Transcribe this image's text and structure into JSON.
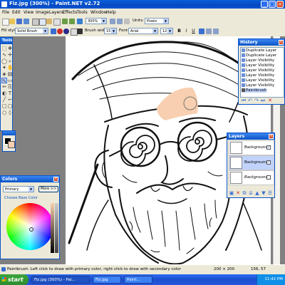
{
  "window": {
    "title": "Fiz.jpg (300%) - Paint.NET v2.72",
    "min_glyph": "_",
    "max_glyph": "□",
    "close_glyph": "×"
  },
  "menu": [
    "File",
    "Edit",
    "View",
    "Image",
    "Layers",
    "Effects",
    "Tools",
    "Window",
    "Help"
  ],
  "toolbar1": {
    "zoom_value": "300%",
    "units_label": "Units:",
    "units_value": "Pixels"
  },
  "toolbar2": {
    "fill_label": "Fill style:",
    "fill_value": "Solid Brush",
    "brush_width_label": "Brush width:",
    "brush_width_value": "15",
    "font_label": "Font:",
    "font_value": "Arial",
    "font_size_value": "12",
    "bold": "B",
    "italic": "I",
    "underline": "U"
  },
  "tools_panel": {
    "title": "Tools",
    "close_glyph": "×"
  },
  "history_panel": {
    "title": "History",
    "close_glyph": "×",
    "items": [
      "Duplicate Layer",
      "Duplicate Layer",
      "Layer Visibility",
      "Layer Visibility",
      "Layer Visibility",
      "Layer Visibility",
      "Layer Visibility",
      "Layer Visibility",
      "Paintbrush"
    ]
  },
  "layers_panel": {
    "title": "Layers",
    "close_glyph": "×",
    "layers": [
      {
        "name": "Background",
        "visible": true,
        "selected": false
      },
      {
        "name": "Background",
        "visible": true,
        "selected": true
      },
      {
        "name": "Background",
        "visible": false,
        "selected": false
      }
    ]
  },
  "colors_panel": {
    "title": "Colors",
    "close_glyph": "×",
    "mode_value": "Primary",
    "more_button": "More >>",
    "choose_label": "Choose Base Color"
  },
  "status": {
    "hint": "Paintbrush: Left click to draw with primary color, right click to draw with secondary color",
    "size": "200 × 200",
    "coords": "156, 57"
  },
  "taskbar": {
    "start_label": "start",
    "tasks": [
      "Fiz.jpg (300%) - Pai...",
      "Fiz.jpg",
      "Paint..."
    ],
    "clock": "11:42 PM"
  },
  "colors": {
    "primary": "#000000",
    "secondary": "#ffffff",
    "skin": "#f8cfb0",
    "accent": "#0a53c9"
  }
}
